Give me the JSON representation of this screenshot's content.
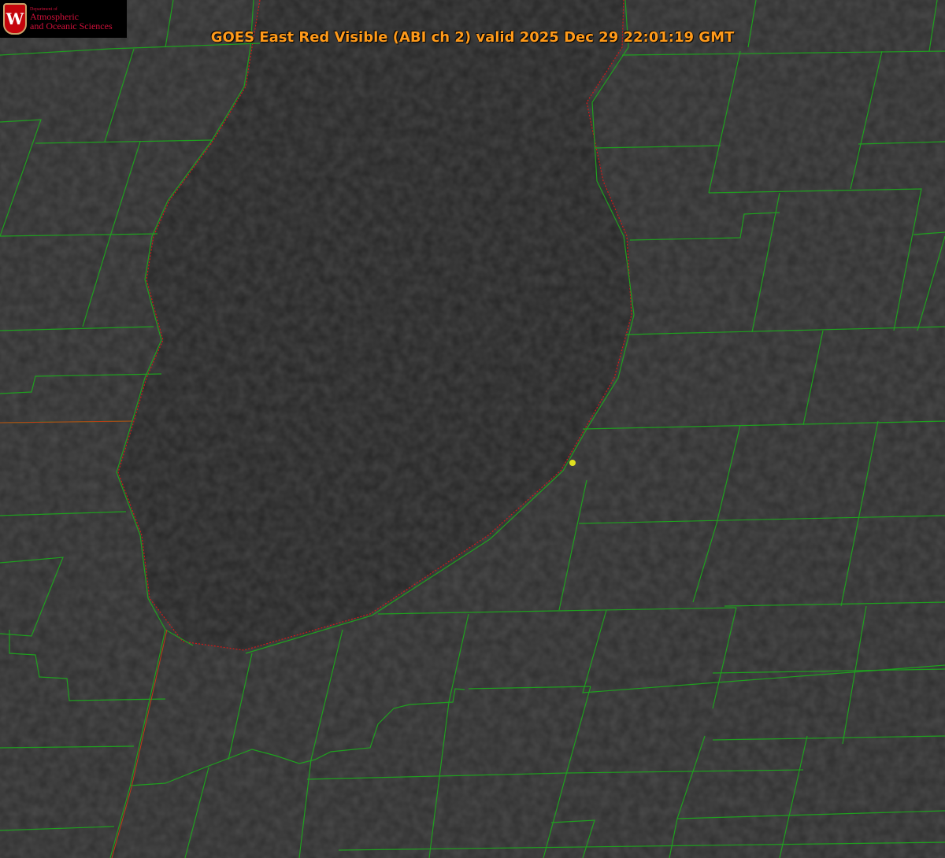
{
  "title": "GOES East Red Visible (ABI ch 2) valid 2025 Dec 29 22:01:19 GMT",
  "logo": {
    "line1": "Department of",
    "line2": "Atmospheric",
    "line3": "and Oceanic Sciences",
    "emblem": "W"
  },
  "colors": {
    "boundary": "#1fa01f",
    "coastline": "#d01818",
    "title": "#ff9a1a",
    "marker": "#e0e020"
  }
}
